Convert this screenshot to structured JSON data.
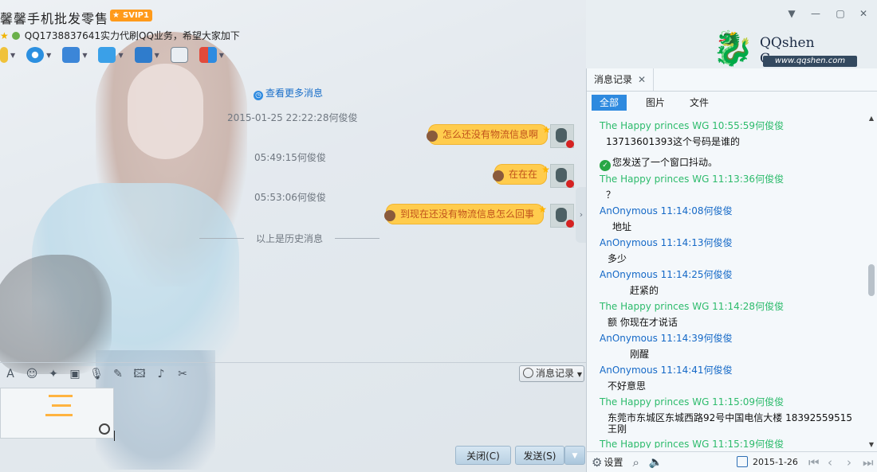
{
  "window": {
    "title": "馨馨手机批发零售",
    "vip_badge": "SVIP1",
    "signature": "QQ1738837641实力代刷QQ业务，希望大家加下",
    "controls": [
      "chevron-down-icon",
      "minimize-icon",
      "maximize-icon",
      "close-icon"
    ]
  },
  "logo": {
    "brand": "QQshen Course",
    "url": "www.qqshen.com"
  },
  "chat": {
    "more_link": "查看更多消息",
    "messages": [
      {
        "time": "2015-01-25 22:22:28何俊俊",
        "text": "怎么还没有物流信息啊"
      },
      {
        "time": "05:49:15何俊俊",
        "text": "在在在"
      },
      {
        "time": "05:53:06何俊俊",
        "text": "到现在还没有物流信息怎么回事"
      }
    ],
    "history_label": "以上是历史消息"
  },
  "input": {
    "msg_record_button": "消息记录",
    "close_button": "关闭(C)",
    "send_button": "发送(S)"
  },
  "panel": {
    "tab_label": "消息记录",
    "filters": [
      "全部",
      "图片",
      "文件"
    ],
    "entries": [
      {
        "head": "The Happy princes  WG 10:55:59何俊俊",
        "color": "green",
        "body": "13713601393这个号码是谁的"
      },
      {
        "head": "",
        "color": "",
        "body": "您发送了一个窗口抖动。",
        "system": true
      },
      {
        "head": "The Happy princes  WG 11:13:36何俊俊",
        "color": "green",
        "body": "？"
      },
      {
        "head": "AnOnymous 11:14:08何俊俊",
        "color": "blue",
        "body": "地址"
      },
      {
        "head": "AnOnymous 11:14:13何俊俊",
        "color": "blue",
        "body": "多少"
      },
      {
        "head": "AnOnymous 11:14:25何俊俊",
        "color": "blue",
        "body": "赶紧的"
      },
      {
        "head": "The Happy princes  WG 11:14:28何俊俊",
        "color": "green",
        "body": "额   你现在才说话"
      },
      {
        "head": "AnOnymous 11:14:39何俊俊",
        "color": "blue",
        "body": "刚醒"
      },
      {
        "head": "AnOnymous 11:14:41何俊俊",
        "color": "blue",
        "body": "不好意思"
      },
      {
        "head": "The Happy princes  WG 11:15:09何俊俊",
        "color": "green",
        "body": "东莞市东城区东城西路92号中国电信大楼   18392559515 王刚"
      },
      {
        "head": "The Happy princes  WG 11:15:19何俊俊",
        "color": "green",
        "body": ""
      }
    ],
    "footer": {
      "settings": "设置",
      "date": "2015-1-26"
    }
  }
}
